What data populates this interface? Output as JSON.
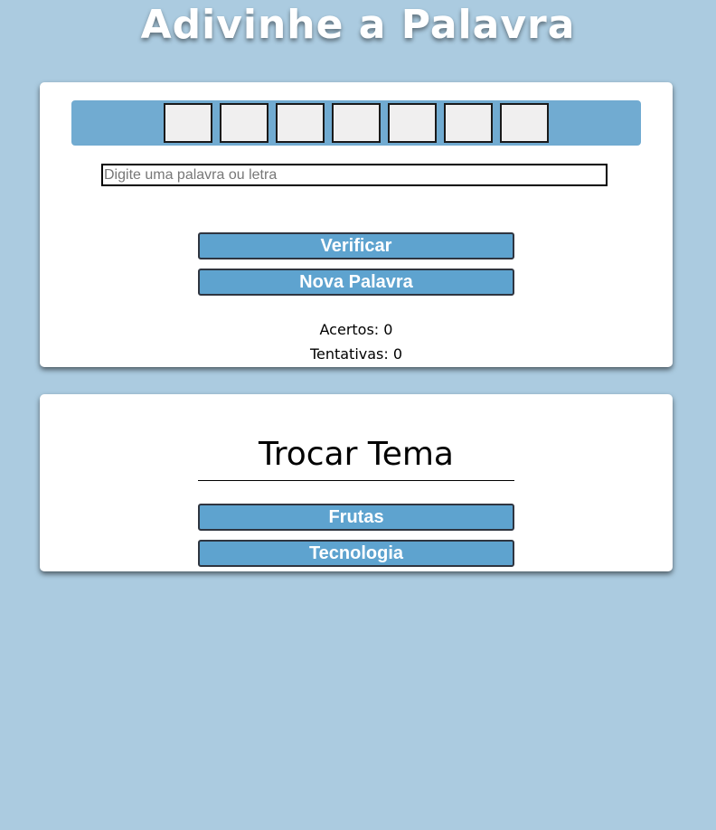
{
  "header": {
    "title": "Adivinhe a Palavra"
  },
  "game": {
    "letters": [
      "",
      "",
      "",
      "",
      "",
      "",
      ""
    ],
    "input": {
      "placeholder": "Digite uma palavra ou letra",
      "value": ""
    },
    "buttons": {
      "verify": "Verificar",
      "new_word": "Nova Palavra"
    },
    "stats": {
      "acertos_label": "Acertos:",
      "acertos_value": "0",
      "tentativas_label": "Tentativas:",
      "tentativas_value": "0"
    }
  },
  "themes": {
    "title": "Trocar Tema",
    "options": [
      "Frutas",
      "Tecnologia"
    ]
  },
  "colors": {
    "background": "#abcbe0",
    "letter_bar": "#71abd1",
    "button": "#5ea3cf",
    "letter_box": "#f0efef"
  }
}
